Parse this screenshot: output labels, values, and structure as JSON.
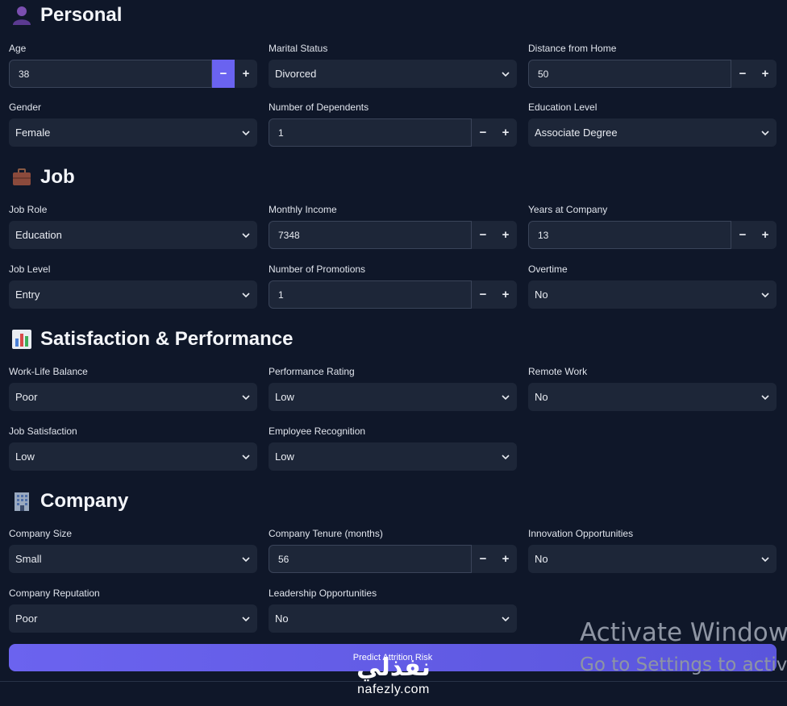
{
  "sections": {
    "personal": {
      "title": "Personal",
      "fields": {
        "age": {
          "label": "Age",
          "value": "38"
        },
        "marital_status": {
          "label": "Marital Status",
          "value": "Divorced"
        },
        "distance_from_home": {
          "label": "Distance from Home",
          "value": "50"
        },
        "gender": {
          "label": "Gender",
          "value": "Female"
        },
        "number_of_dependents": {
          "label": "Number of Dependents",
          "value": "1"
        },
        "education_level": {
          "label": "Education Level",
          "value": "Associate Degree"
        }
      }
    },
    "job": {
      "title": "Job",
      "fields": {
        "job_role": {
          "label": "Job Role",
          "value": "Education"
        },
        "monthly_income": {
          "label": "Monthly Income",
          "value": "7348"
        },
        "years_at_company": {
          "label": "Years at Company",
          "value": "13"
        },
        "job_level": {
          "label": "Job Level",
          "value": "Entry"
        },
        "number_of_promotions": {
          "label": "Number of Promotions",
          "value": "1"
        },
        "overtime": {
          "label": "Overtime",
          "value": "No"
        }
      }
    },
    "satisfaction": {
      "title": "Satisfaction & Performance",
      "fields": {
        "work_life_balance": {
          "label": "Work-Life Balance",
          "value": "Poor"
        },
        "performance_rating": {
          "label": "Performance Rating",
          "value": "Low"
        },
        "remote_work": {
          "label": "Remote Work",
          "value": "No"
        },
        "job_satisfaction": {
          "label": "Job Satisfaction",
          "value": "Low"
        },
        "employee_recognition": {
          "label": "Employee Recognition",
          "value": "Low"
        }
      }
    },
    "company": {
      "title": "Company",
      "fields": {
        "company_size": {
          "label": "Company Size",
          "value": "Small"
        },
        "company_tenure": {
          "label": "Company Tenure (months)",
          "value": "56"
        },
        "innovation_opportunities": {
          "label": "Innovation Opportunities",
          "value": "No"
        },
        "company_reputation": {
          "label": "Company Reputation",
          "value": "Poor"
        },
        "leadership_opportunities": {
          "label": "Leadership Opportunities",
          "value": "No"
        }
      }
    }
  },
  "stepper": {
    "minus": "−",
    "plus": "+"
  },
  "predict_button": {
    "label": "Predict Attrition Risk"
  },
  "watermark": {
    "line1": "Activate Windows",
    "line2": "Go to Settings to activate Windows."
  },
  "logo": {
    "arabic": "نفذلي",
    "latin": "nafezly.com"
  },
  "colors": {
    "accent": "#6a63f0",
    "background": "#0f1729",
    "field": "#1d2638"
  },
  "icons": {
    "personal": "person-icon",
    "job": "briefcase-icon",
    "satisfaction": "bar-chart-icon",
    "company": "office-building-icon"
  }
}
